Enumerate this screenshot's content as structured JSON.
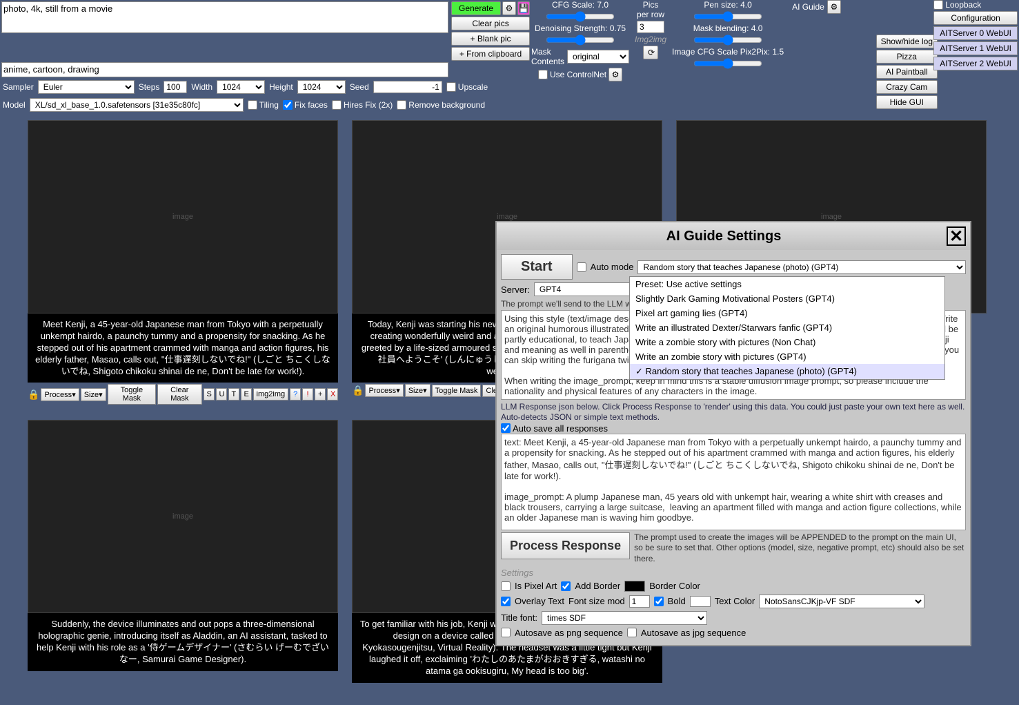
{
  "prompt": "photo, 4k, still from a movie",
  "neg_prompt": "anime, cartoon, drawing",
  "generate": "Generate",
  "clear_pics": "Clear pics",
  "blank_pic": "+ Blank pic",
  "from_clip": "+ From clipboard",
  "cfg_scale": "CFG Scale: 7.0",
  "denoising": "Denoising Strength: 0.75",
  "mask_contents": "Mask\nContents",
  "mask_contents_val": "original",
  "pics_per_row": "Pics\nper row",
  "pics_per_row_val": "3",
  "img2img_lbl": "Img2img",
  "pen_size": "Pen size: 4.0",
  "mask_blend": "Mask blending: 4.0",
  "img_cfg_pix": "Image CFG Scale Pix2Pix: 1.5",
  "ai_guide": "AI Guide",
  "loopback": "Loopback",
  "configuration": "Configuration",
  "showhide": "Show/hide log",
  "pizza": "Pizza",
  "paintball": "AI Paintball",
  "crazycam": "Crazy Cam",
  "hidegui": "Hide GUI",
  "servers": [
    "AITServer 0 WebUI",
    "AITServer 1 WebUI",
    "AITServer 2 WebUI"
  ],
  "sampler": "Sampler",
  "sampler_val": "Euler",
  "steps": "Steps",
  "steps_val": "100",
  "width": "Width",
  "width_val": "1024",
  "height": "Height",
  "height_val": "1024",
  "seed": "Seed",
  "seed_val": "-1",
  "model": "Model",
  "model_val": "XL/sd_xl_base_1.0.safetensors [31e35c80fc]",
  "tiling": "Tiling",
  "fixfaces": "Fix faces",
  "hiresfix": "Hires Fix (2x)",
  "removebg": "Remove background",
  "upscale": "Upscale",
  "controlnet": "Use ControlNet",
  "tile": {
    "process": "Process",
    "size": "Size",
    "toggle_mask": "Toggle Mask",
    "clear_mask": "Clear Mask",
    "img2img": "img2img"
  },
  "captions": [
    "Meet Kenji, a 45-year-old Japanese man from Tokyo with a perpetually unkempt hairdo, a paunchy tummy and a propensity for snacking. As he stepped out of his apartment crammed with manga and action figures, his elderly father, Masao, calls out, \"仕事遅刻しないでね!\" (しごと ちこくしないでね, Shigoto chikoku shinai de ne, Don't be late for work!).",
    "Today, Kenji was starting his new job at a gaming company famous for creating wonderfully weird and addictive games. Upon entering, he is greeted by a life-sized armoured suit holding a welcome sign saying '新入社員へようこそ' (しんにゅうしゃいんへようこそ, new employee welcome).",
    "",
    "Suddenly, the device illuminates and out pops a three-dimensional holographic genie, introducing itself as Aladdin, an AI assistant, tasked to help Kenji with his role as a '侍ゲームデザイナー' (さむらい げーむでざいなー, Samurai Game Designer).",
    "To get familiar with his job, Kenji was shown a virtual reality learning game design on a device called the '仮想現実' (かそうげんじつ, Kyokasougenjitsu, Virtual Reality). The headset was a little tight but Kenji laughed it off, exclaiming 'わたしのあたまがおおきすぎる, watashi no atama ga ookisugiru, My head is too big'."
  ],
  "modal": {
    "title": "AI Guide Settings",
    "start": "Start",
    "auto_mode": "Auto mode",
    "preset_val": "Random story that teaches Japanese (photo) (GPT4)",
    "server": "Server:",
    "server_val": "GPT4",
    "prompt_label": "The prompt we'll send to the LLM when Start is pressed below.",
    "presets": [
      "Preset: Use active settings",
      "Slightly Dark Gaming Motivational Posters (GPT4)",
      "Pixel art gaming lies (GPT4)",
      "Write an illustrated Dexter/Starwars fanfic (GPT4)",
      "Write a zombie story with pictures (Non Chat)",
      "Write an zombie story with pictures (GPT4)",
      "Random story that teaches Japanese (photo) (GPT4)"
    ],
    "prompt_text": "Using this style (text/image description), first decide on a random Japanese character and their background.  Write an original humorous illustrated twenty panel story about the trials and tribulations of their life.  The story should be partly educational, to teach Japanese words and phrases. When showing Japanese, include the furigana, romaji and meaning as well in parenthesis so learners can understand it as they read.  If the word is already furigana, you can skip writing the furigana twice.\n\nWhen writing the image_prompt, keep in mind this is a stable diffusion image prompt, so please include the nationality and physical features of any characters in the image.",
    "response_info": "LLM Response json below. Click Process Response to 'render' using this data.  You could just paste your own text here as well.  Auto-detects JSON or simple text methods.",
    "autosave": "Auto save all responses",
    "response_text": "text: Meet Kenji, a 45-year-old Japanese man from Tokyo with a perpetually unkempt hairdo, a paunchy tummy and a propensity for snacking. As he stepped out of his apartment crammed with manga and action figures, his elderly father, Masao, calls out, \"仕事遅刻しないでね!\" (しごと ちこくしないでね, Shigoto chikoku shinai de ne, Don't be late for work!).\n\nimage_prompt: A plump Japanese man, 45 years old with unkempt hair, wearing a white shirt with creases and black trousers, carrying a large suitcase,  leaving an apartment filled with manga and action figure collections, while an older Japanese man is waving him goodbye.",
    "process_response": "Process Response",
    "append_info": "The prompt used to create the images will be APPENDED to the prompt on the main UI, so be sure to set that.  Other options (model, size, negative prompt, etc) should also be set there.",
    "settings": "Settings",
    "pixel_art": "Is Pixel Art",
    "add_border": "Add Border",
    "border_color": "Border Color",
    "overlay": "Overlay Text",
    "fontsize": "Font size mod",
    "fontsize_val": "1",
    "bold": "Bold",
    "text_color": "Text Color",
    "font_val": "NotoSansCJKjp-VF SDF",
    "title_font": "Title font:",
    "title_font_val": "times SDF",
    "autosave_png": "Autosave as png sequence",
    "autosave_jpg": "Autosave as jpg sequence"
  }
}
